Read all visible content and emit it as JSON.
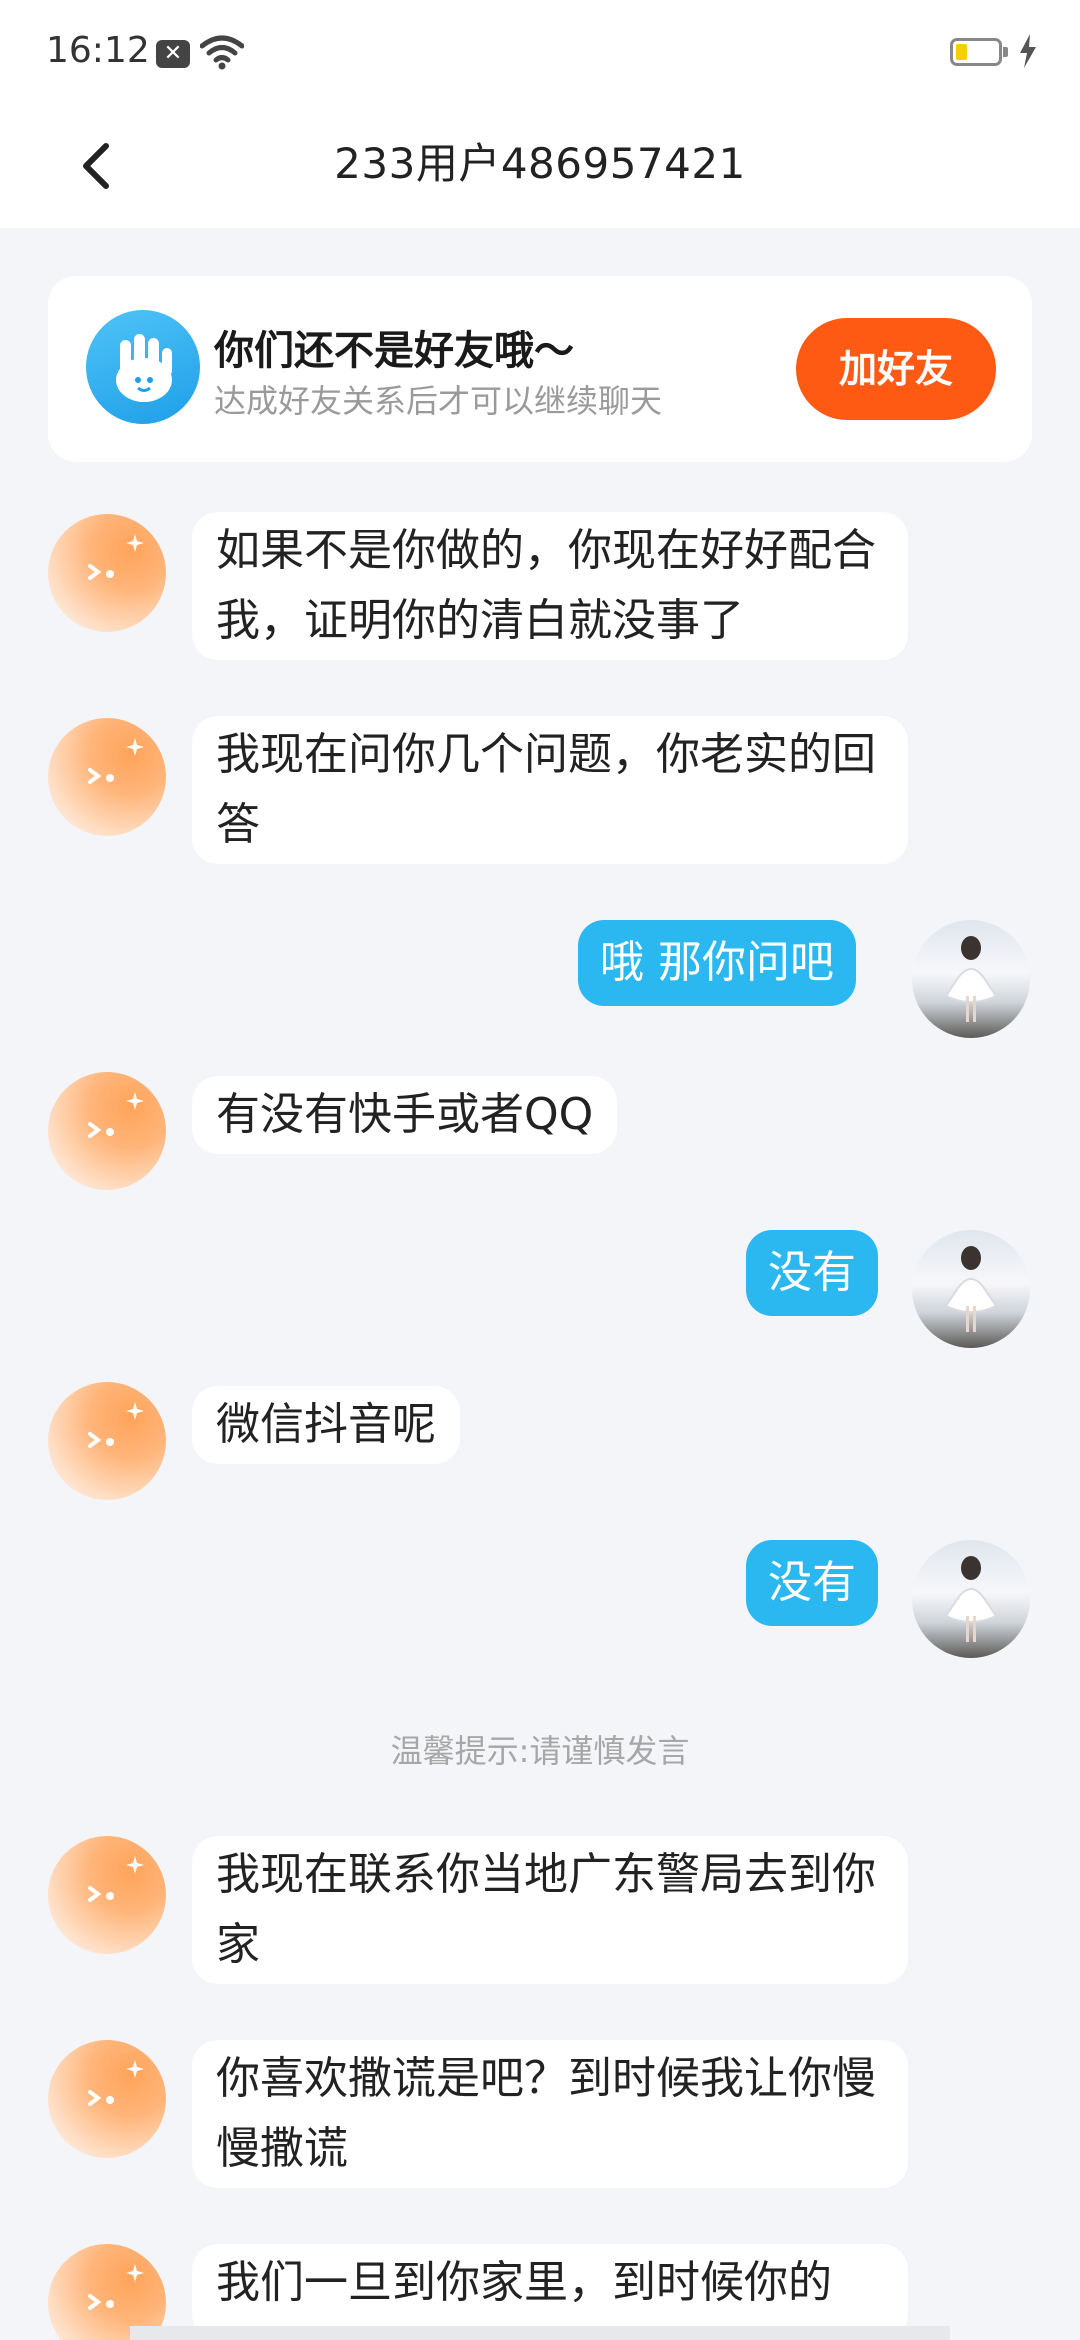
{
  "status_bar": {
    "time": "16:12"
  },
  "header": {
    "title": "233用户486957421"
  },
  "friend_notice": {
    "title": "你们还不是好友哦～",
    "subtitle": "达成好友关系后才可以继续聊天",
    "button_label": "加好友"
  },
  "messages": [
    {
      "side": "left",
      "text": "如果不是你做的，你现在好好配合我，证明你的清白就没事了"
    },
    {
      "side": "left",
      "text": "我现在问你几个问题，你老实的回答"
    },
    {
      "side": "right",
      "text": "哦 那你问吧"
    },
    {
      "side": "left",
      "text": "有没有快手或者QQ"
    },
    {
      "side": "right",
      "text": "没有"
    },
    {
      "side": "left",
      "text": "微信抖音呢"
    },
    {
      "side": "right",
      "text": "没有"
    },
    {
      "side": "left",
      "text": "我现在联系你当地广东警局去到你家"
    },
    {
      "side": "left",
      "text": "你喜欢撒谎是吧？到时候我让你慢慢撒谎"
    },
    {
      "side": "left",
      "text": "我们一旦到你家里，到时候你的"
    }
  ],
  "system_notice": "温馨提示:请谨慎发言",
  "colors": {
    "accent": "#2bb8f0",
    "button": "#ff5a14",
    "background": "#f3f5f9"
  }
}
